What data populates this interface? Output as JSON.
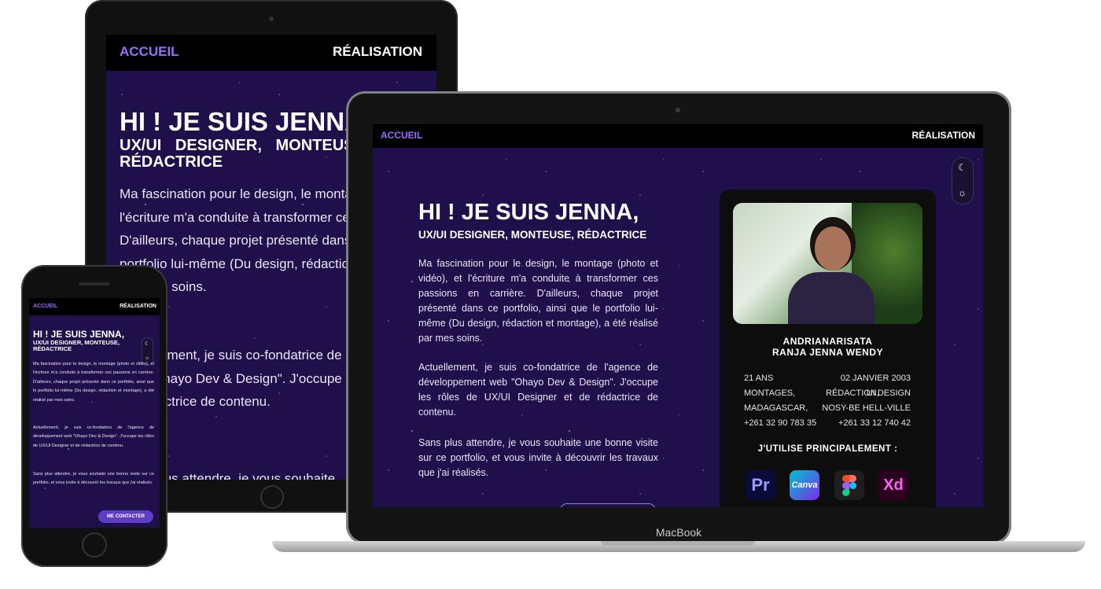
{
  "nav": {
    "home": "ACCUEIL",
    "work": "RÉALISATION"
  },
  "hero": {
    "title": "HI ! JE SUIS JENNA,",
    "subtitle": "UX/UI DESIGNER, MONTEUSE, RÉDACTRICE",
    "p1": "Ma fascination pour le design, le montage (photo et vidéo), et l'écriture m'a conduite à transformer ces passions en carrière. D'ailleurs, chaque projet présenté dans ce portfolio, ainsi que le portfolio lui-même (Du design, rédaction et montage), a été réalisé par mes soins.",
    "p2": "Actuellement, je suis co-fondatrice de l'agence de développement web \"Ohayo Dev & Design\". J'occupe les rôles de UX/UI Designer et de rédactrice de contenu.",
    "p3": "Sans plus attendre, je vous souhaite une bonne visite sur ce portfolio, et vous invite à découvrir les travaux que j'ai réalisés."
  },
  "tablet": {
    "p1": "Ma fascination pour le design, le montage (photo et vidéo), et l'écriture m'a conduite à transformer ces passions en carrière. D'ailleurs, chaque projet présenté dans ce portfolio, ainsi que le portfolio lui-même (Du design, rédaction et montage), a été réalisé par mes soins.",
    "p2": "Actuellement, je suis co-fondatrice de l'agence de développement web \"Ohayo Dev & Design\". J'occupe les rôles de UX/UI Designer et de rédactrice de contenu.",
    "p3": "Sans plus attendre, je vous souhaite"
  },
  "cta": "ME CONTACTER",
  "profile": {
    "name_line1": "ANDRIANARISATA",
    "name_line2": "RANJA JENNA WENDY",
    "age": "21 ANS",
    "birthdate": "02 JANVIER 2003",
    "skills_left": "MONTAGES,",
    "skills_mid": "RÉDACTION,",
    "skills_right": "UI DESIGN",
    "country": "MADAGASCAR,",
    "city": "NOSY-BE HELL-VILLE",
    "phone1": "+261 32 90 783 35",
    "phone2": "+261 33 12 740 42",
    "tools_heading": "J'UTILISE PRINCIPALEMENT :",
    "tools": [
      {
        "label": "Pr",
        "icon": "premiere-pro-icon"
      },
      {
        "label": "Canva",
        "icon": "canva-icon"
      },
      {
        "label": "",
        "icon": "figma-icon"
      },
      {
        "label": "Xd",
        "icon": "adobe-xd-icon"
      }
    ]
  },
  "device": {
    "laptop_brand": "MacBook"
  },
  "colors": {
    "accent": "#9b6dff",
    "background": "#1f0f4a",
    "button": "#5b3ec4"
  }
}
